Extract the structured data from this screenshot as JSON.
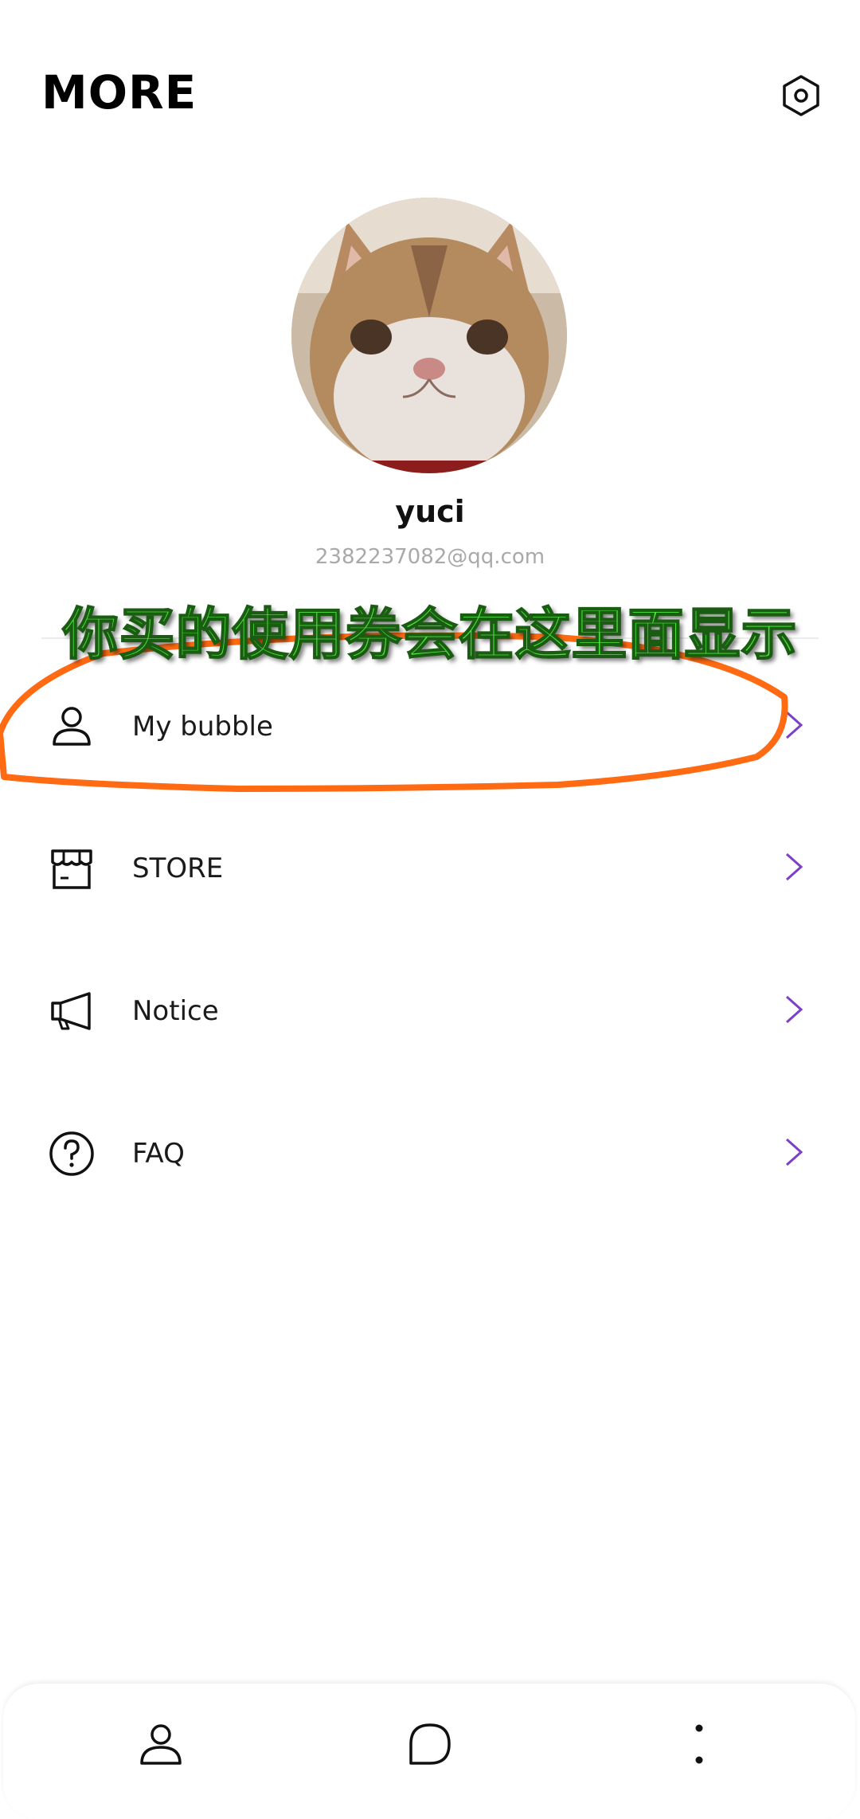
{
  "header": {
    "title": "MORE",
    "settings_icon": "settings-hexagon-icon"
  },
  "profile": {
    "name": "yuci",
    "email": "2382237082@qq.com",
    "avatar_icon": "cat-avatar-photo"
  },
  "overlay": {
    "caption": "你买的使用券会在这里面显示",
    "caption_color": "#4ee63e",
    "highlight_color": "#ff6a13"
  },
  "menu": [
    {
      "label": "My bubble",
      "icon": "person-icon"
    },
    {
      "label": "STORE",
      "icon": "store-icon"
    },
    {
      "label": "Notice",
      "icon": "megaphone-icon"
    },
    {
      "label": "FAQ",
      "icon": "question-circle-icon"
    }
  ],
  "accent_color": "#7b3fc8",
  "bottom_nav": [
    {
      "icon": "person-icon"
    },
    {
      "icon": "chat-bubble-icon"
    },
    {
      "icon": "more-dots-icon"
    }
  ]
}
